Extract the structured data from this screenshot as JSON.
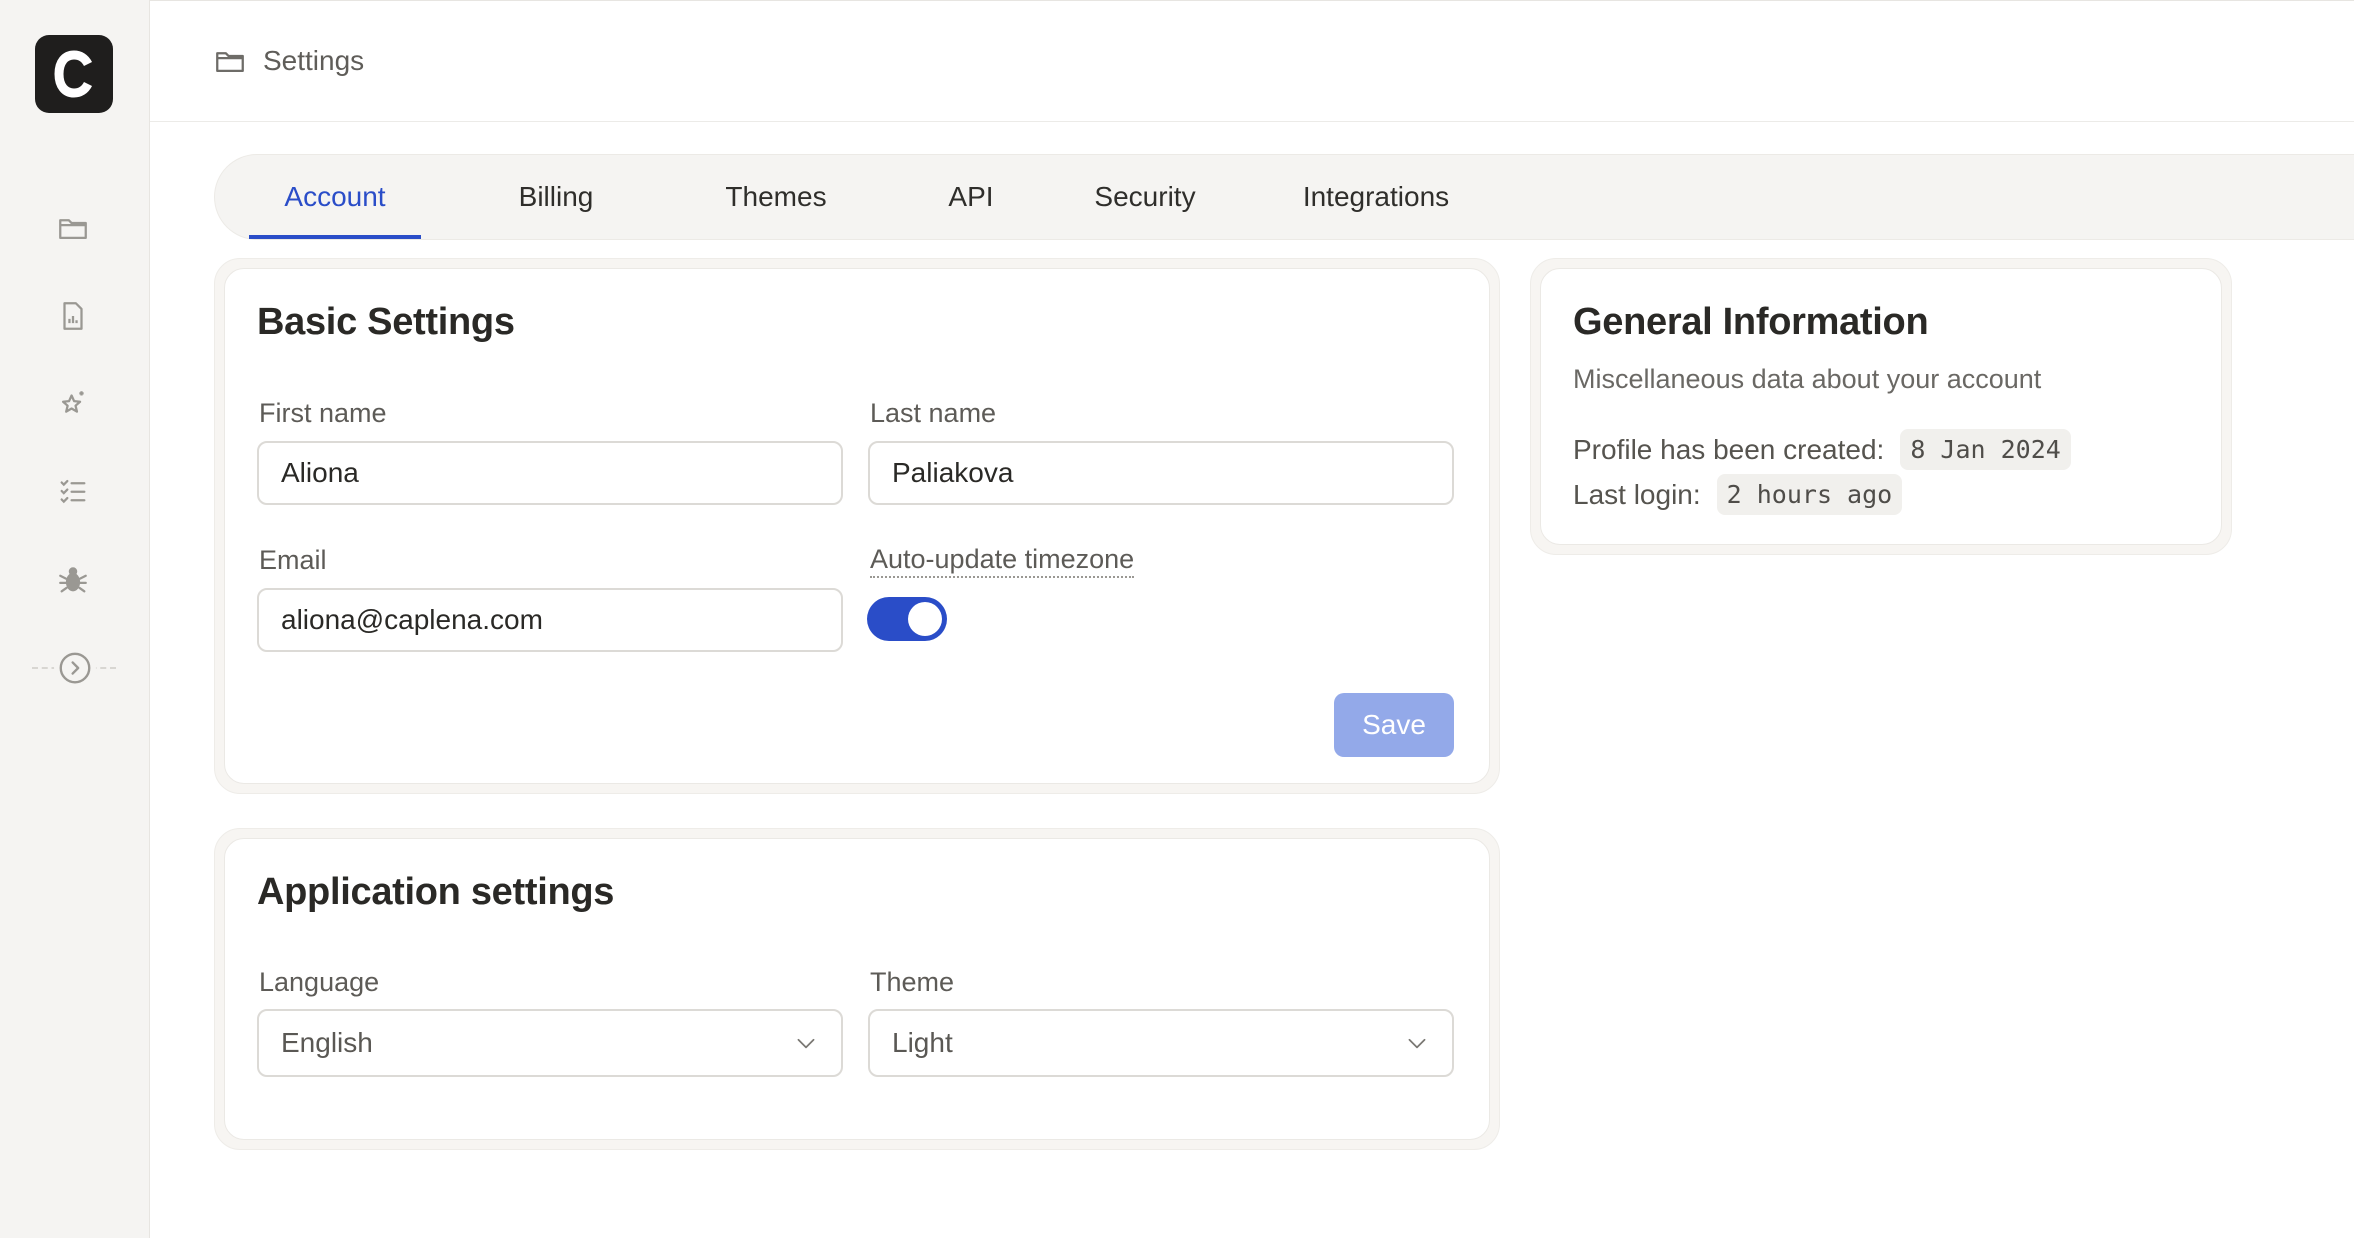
{
  "header": {
    "title": "Settings"
  },
  "sidebar": {
    "logo": "C",
    "items": [
      {
        "icon": "folder-icon"
      },
      {
        "icon": "report-icon"
      },
      {
        "icon": "sparkle-star-icon"
      },
      {
        "icon": "checklist-icon"
      },
      {
        "icon": "bug-icon"
      }
    ],
    "expand_icon": "chevron-right-circle-icon"
  },
  "tabs": [
    {
      "label": "Account",
      "active": true
    },
    {
      "label": "Billing"
    },
    {
      "label": "Themes"
    },
    {
      "label": "API"
    },
    {
      "label": "Security"
    },
    {
      "label": "Integrations"
    }
  ],
  "basic_settings": {
    "title": "Basic Settings",
    "first_name_label": "First name",
    "first_name_value": "Aliona",
    "last_name_label": "Last name",
    "last_name_value": "Paliakova",
    "email_label": "Email",
    "email_value": "aliona@caplena.com",
    "timezone_label": "Auto-update timezone",
    "timezone_enabled": true,
    "save_label": "Save"
  },
  "app_settings": {
    "title": "Application settings",
    "language_label": "Language",
    "language_value": "English",
    "theme_label": "Theme",
    "theme_value": "Light"
  },
  "general_info": {
    "title": "General Information",
    "subtitle": "Miscellaneous data about your account",
    "created_label": "Profile has been created:",
    "created_value": "8 Jan 2024",
    "last_login_label": "Last login:",
    "last_login_value": "2 hours ago"
  },
  "colors": {
    "accent": "#2a4dc8",
    "save_button": "#93a9e9",
    "sidebar_bg": "#f5f4f2"
  }
}
